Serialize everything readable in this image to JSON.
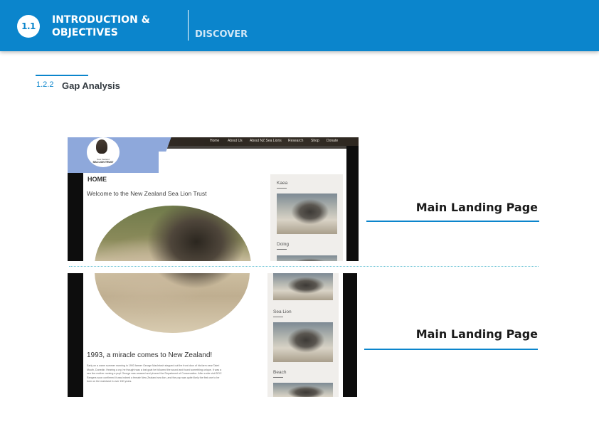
{
  "header": {
    "section_number": "1.1",
    "title_line1": "INTRODUCTION &",
    "title_line2": "OBJECTIVES",
    "tab": "DISCOVER"
  },
  "subsection": {
    "number": "1.2.2",
    "title": "Gap Analysis"
  },
  "screenshot_top": {
    "logo_line1": "New Zealand",
    "logo_line2": "SEA LION TRUST",
    "nav": [
      "Home",
      "About Us",
      "About NZ Sea Lions",
      "Research",
      "Shop",
      "Donate"
    ],
    "heading": "HOME",
    "welcome": "Welcome to the New Zealand Sea Lion Trust",
    "sidebar": [
      {
        "label": "Kaea"
      },
      {
        "label": "Doing"
      }
    ]
  },
  "screenshot_bottom": {
    "article_title": "1993, a miracle comes to New Zealand!",
    "article_lines": [
      "Early on a warm summer morning in 1993 farmer George MacIntosh stepped out the front door of his farm near Taieri",
      "Mouth, Dunedin. Hearing a cry, he thought was a lost goat he followed the sound and found something unique. It was a",
      "sea lion mother nursing a pup! George was amazed and phoned the Department of Conservation. After a site visit DOC",
      "Rangers soon confirmed it was indeed a female New Zealand sea lion, and the pup was quite likely the first one to be",
      "born on the mainland in over 150 years."
    ],
    "sidebar": [
      {
        "label": "Sea Lion"
      },
      {
        "label": "Beach"
      }
    ]
  },
  "captions": {
    "top": "Main Landing Page",
    "bottom": "Main Landing Page"
  },
  "colors": {
    "brand_blue": "#0b85cc",
    "logo_panel": "#8ea8db"
  }
}
